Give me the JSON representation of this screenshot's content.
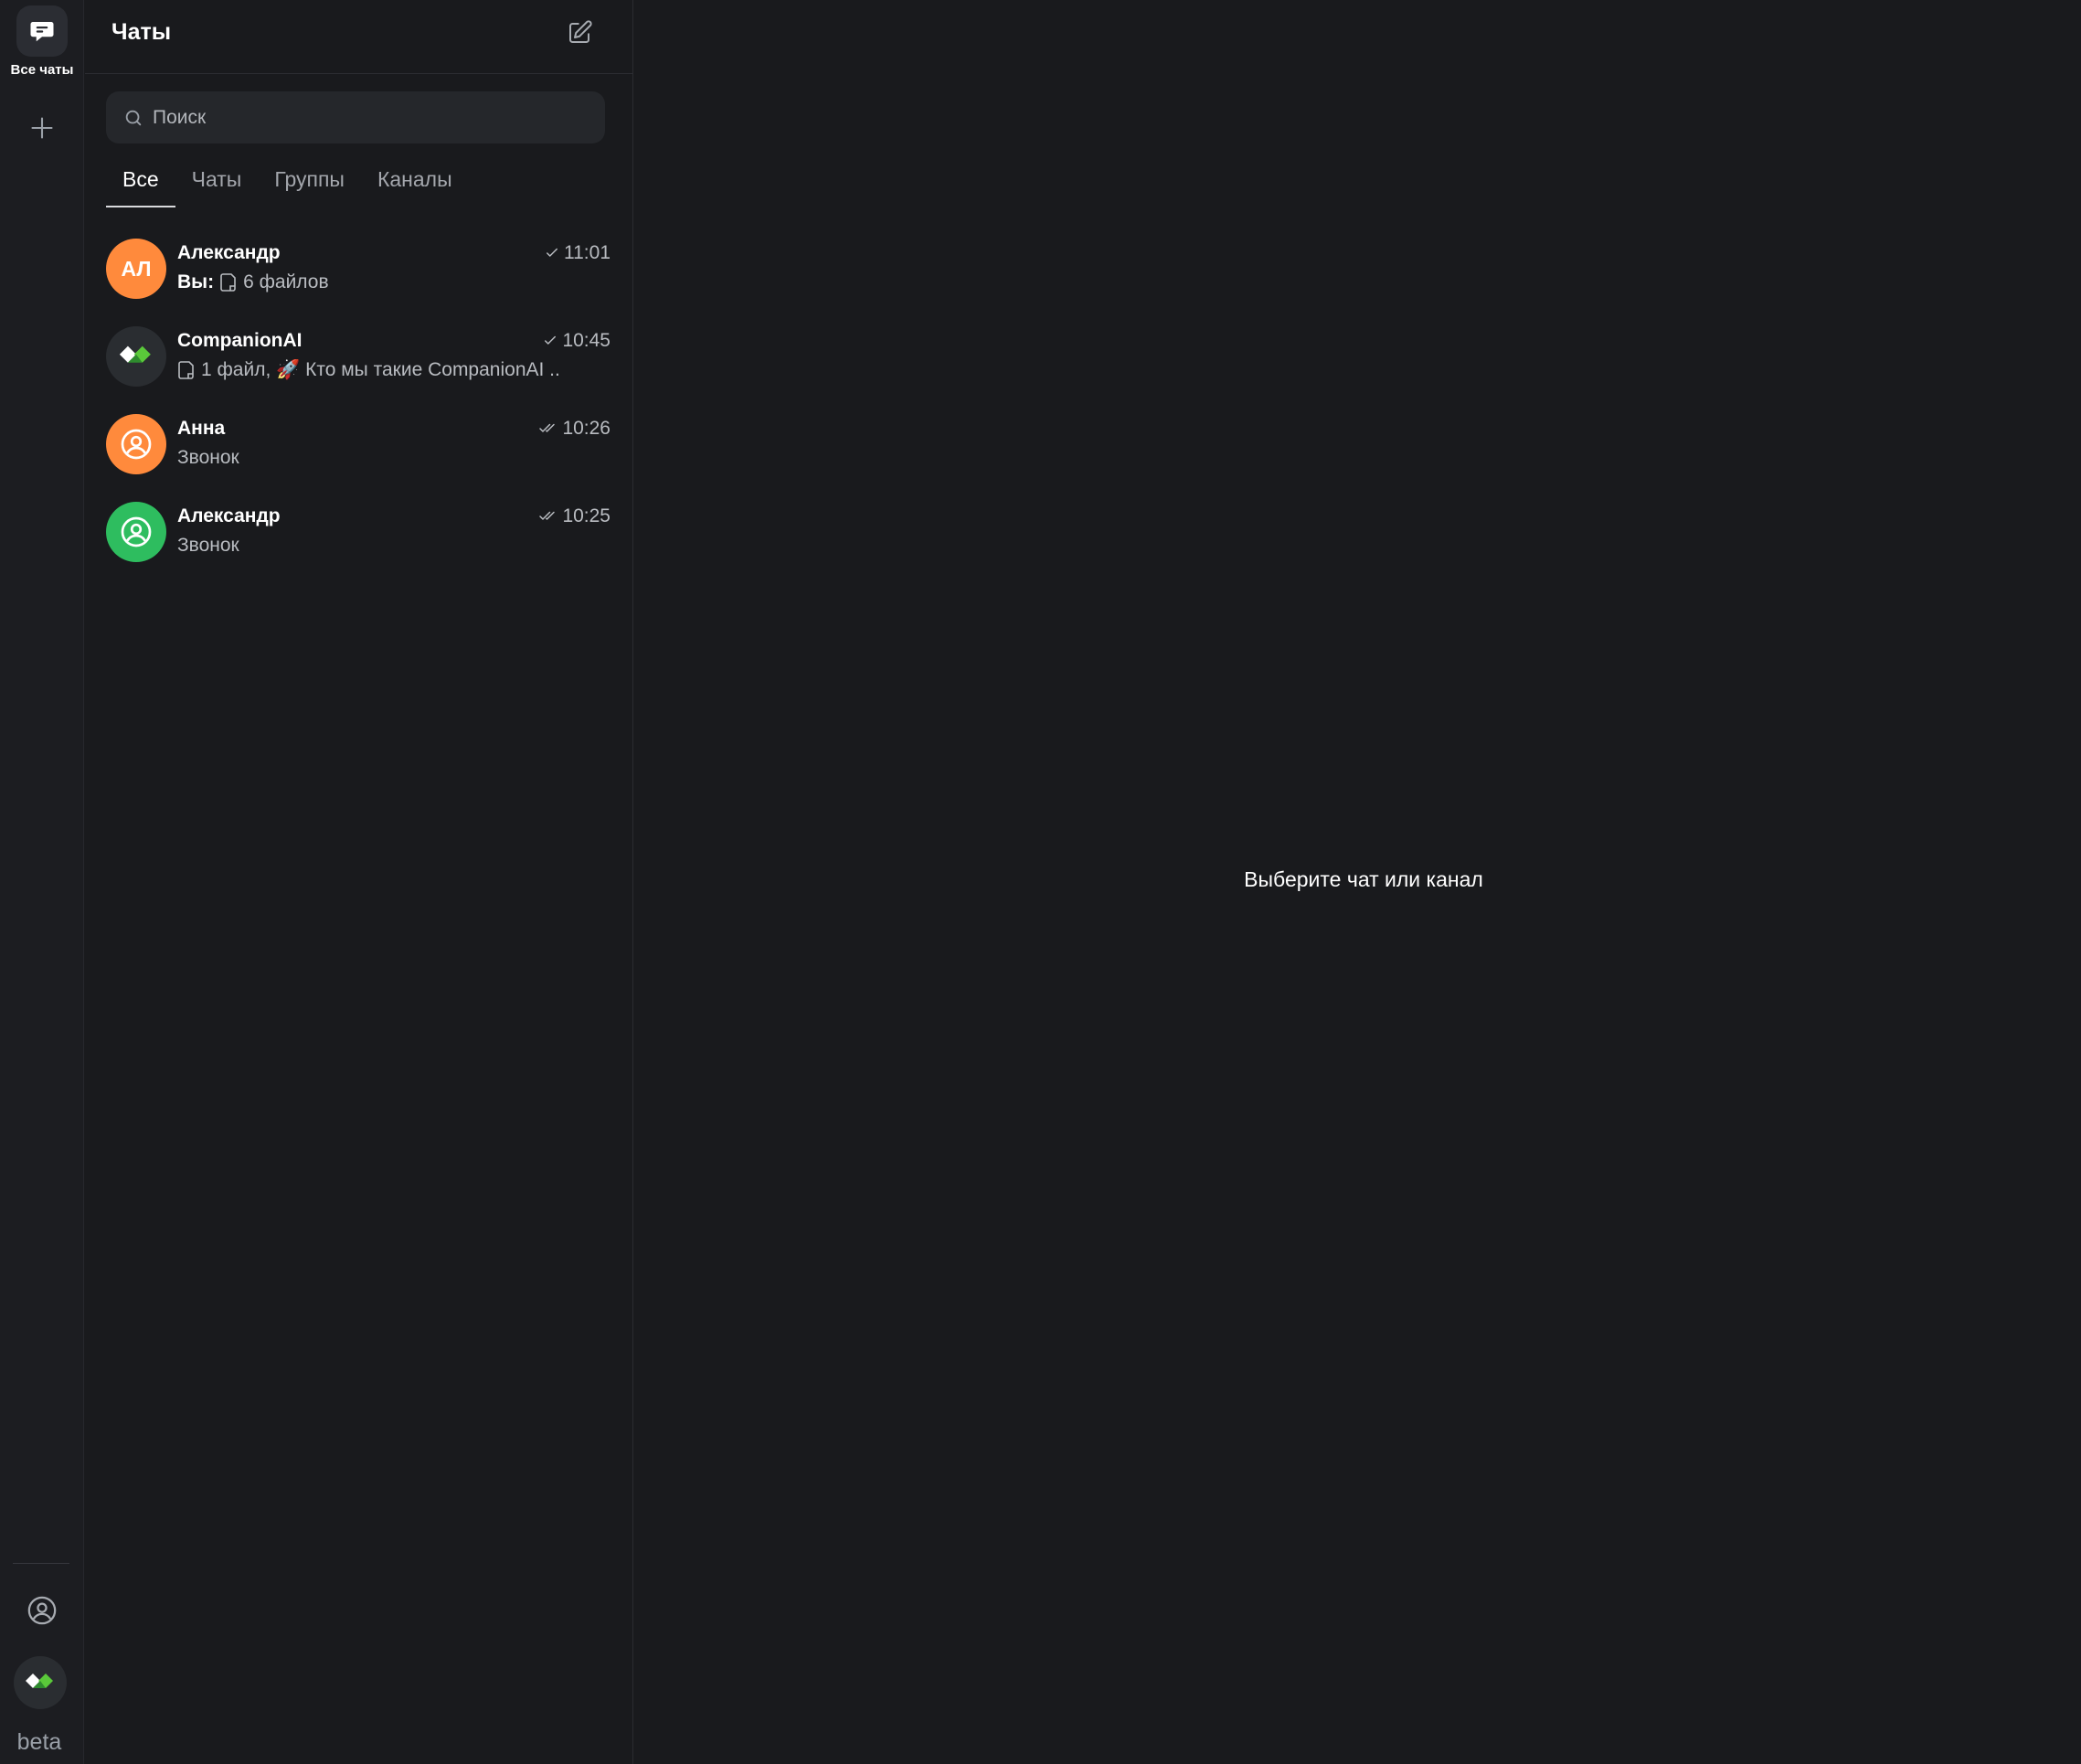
{
  "rail": {
    "all_chats_label": "Все чаты",
    "beta_label": "beta"
  },
  "panel": {
    "title": "Чаты",
    "search_placeholder": "Поиск",
    "tabs": [
      {
        "label": "Все",
        "active": true
      },
      {
        "label": "Чаты",
        "active": false
      },
      {
        "label": "Группы",
        "active": false
      },
      {
        "label": "Каналы",
        "active": false
      }
    ]
  },
  "chats": [
    {
      "name": "Александр",
      "avatar_initials": "АЛ",
      "avatar_color": "#ff8a3c",
      "time": "11:01",
      "status": "sent",
      "preview_prefix": "Вы:",
      "preview": "6 файлов",
      "preview_icon": "file-icon"
    },
    {
      "name": "CompanionAI",
      "avatar_initials": "",
      "avatar_color": "#2a2d31",
      "time": "10:45",
      "status": "sent",
      "preview_prefix": "",
      "preview": "1 файл, 🚀 Кто мы такие CompanionAI ...",
      "preview_icon": "file-icon"
    },
    {
      "name": "Анна",
      "avatar_initials": "",
      "avatar_color": "#ff8a3c",
      "time": "10:26",
      "status": "read",
      "preview_prefix": "",
      "preview": "Звонок",
      "preview_icon": ""
    },
    {
      "name": "Александр",
      "avatar_initials": "",
      "avatar_color": "#2ebd5f",
      "time": "10:25",
      "status": "read",
      "preview_prefix": "",
      "preview": "Звонок",
      "preview_icon": ""
    }
  ],
  "main": {
    "empty_message": "Выберите чат или канал"
  },
  "colors": {
    "background": "#191a1d",
    "rail": "#1c1d21",
    "search_bg": "#25272b",
    "accent_orange": "#ff8a3c",
    "accent_green": "#2ebd5f"
  }
}
